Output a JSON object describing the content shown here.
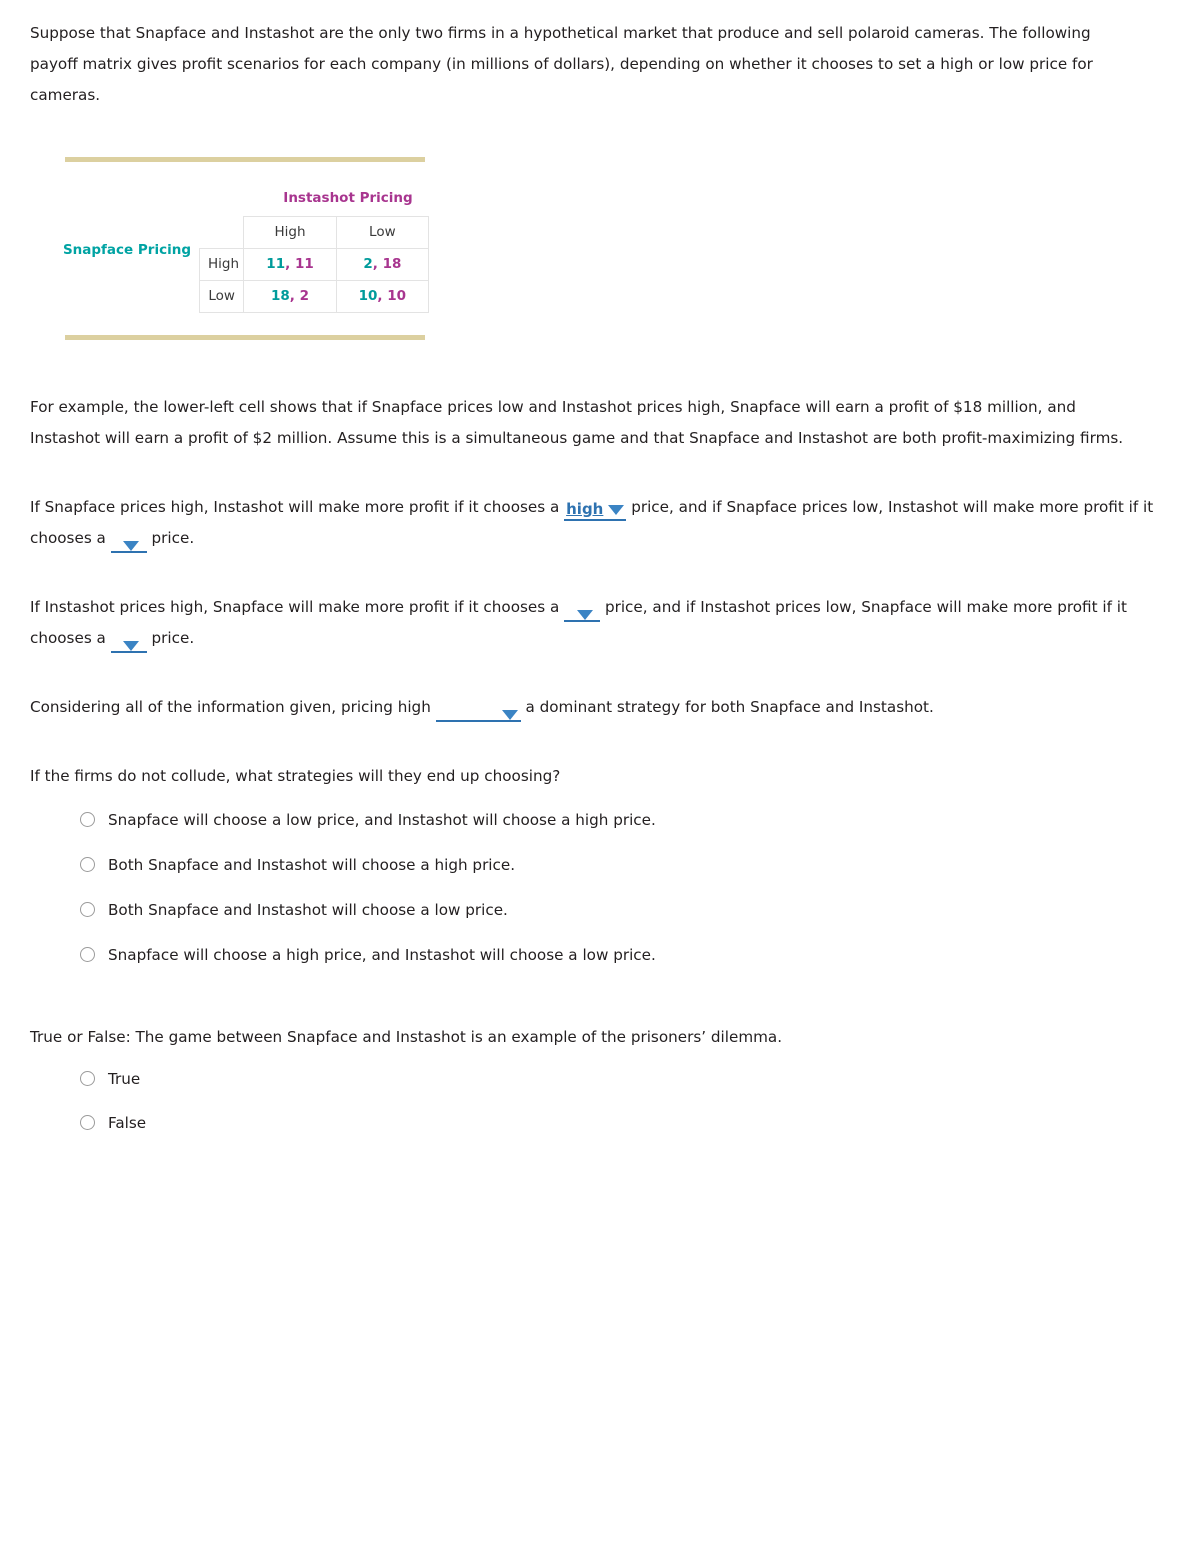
{
  "intro": {
    "text": "Suppose that Snapface and Instashot are the only two firms in a hypothetical market that produce and sell polaroid cameras. The following payoff matrix gives profit scenarios for each company (in millions of dollars), depending on whether it chooses to set a high or low price for cameras."
  },
  "matrix": {
    "column_axis_label": "Instashot Pricing",
    "row_axis_label": "Snapface Pricing",
    "column_headers": [
      "High",
      "Low"
    ],
    "row_headers": [
      "High",
      "Low"
    ],
    "cells": [
      [
        {
          "snapface": "11",
          "instashot": "11",
          "sep": ","
        },
        {
          "snapface": "2",
          "instashot": "18",
          "sep": ","
        }
      ],
      [
        {
          "snapface": "18",
          "instashot": "2",
          "sep": ","
        },
        {
          "snapface": "10",
          "instashot": "10",
          "sep": ","
        }
      ]
    ],
    "colors": {
      "snapface_value": "#009b9b",
      "instashot_value": "#a8358f",
      "rule": "#dcd0a0",
      "cell_border": "#e3e3e3"
    }
  },
  "example": {
    "text": "For example, the lower-left cell shows that if Snapface prices low and Instashot prices high, Snapface will earn a profit of $18 million, and Instashot will earn a profit of $2 million. Assume this is a simultaneous game and that Snapface and Instashot are both profit-maximizing firms."
  },
  "q1": {
    "part1": "If Snapface prices high, Instashot will make more profit if it chooses a",
    "dropdown1": "high",
    "part2": "price, and if Snapface prices low, Instashot will make more profit if it chooses a",
    "dropdown2": "",
    "part3": "price."
  },
  "q2": {
    "part1": "If Instashot prices high, Snapface will make more profit if it chooses a",
    "dropdown1": "",
    "part2": "price, and if Instashot prices low, Snapface will make more profit if it chooses a",
    "dropdown2": "",
    "part3": "price."
  },
  "q3": {
    "part1": "Considering all of the information given, pricing high",
    "dropdown1": "",
    "part2": "a dominant strategy for both Snapface and Instashot."
  },
  "q4": {
    "prompt": "If the firms do not collude, what strategies will they end up choosing?",
    "options": [
      "Snapface will choose a low price, and Instashot will choose a high price.",
      "Both Snapface and Instashot will choose a high price.",
      "Both Snapface and Instashot will choose a low price.",
      "Snapface will choose a high price, and Instashot will choose a low price."
    ]
  },
  "q5": {
    "prompt": "True or False: The game between Snapface and Instashot is an example of the prisoners’ dilemma.",
    "options": [
      "True",
      "False"
    ]
  }
}
